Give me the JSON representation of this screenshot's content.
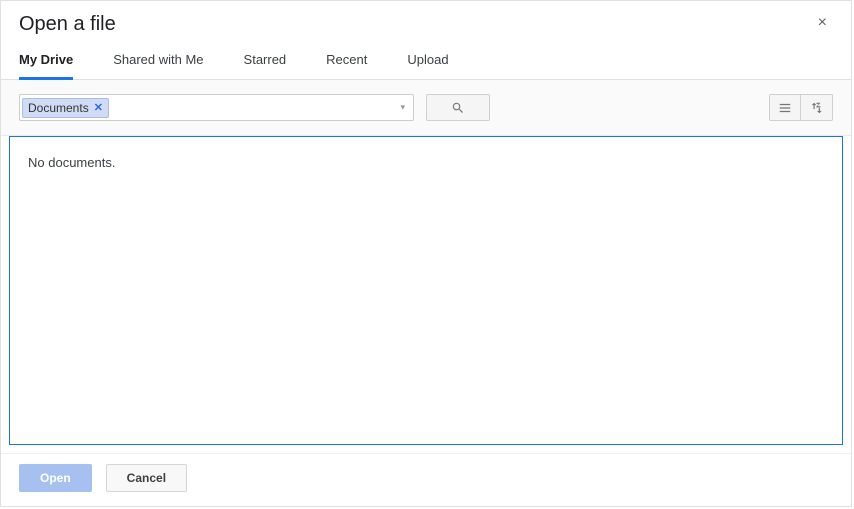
{
  "dialog": {
    "title": "Open a file",
    "close_symbol": "×"
  },
  "tabs": [
    {
      "label": "My Drive",
      "active": true
    },
    {
      "label": "Shared with Me",
      "active": false
    },
    {
      "label": "Starred",
      "active": false
    },
    {
      "label": "Recent",
      "active": false
    },
    {
      "label": "Upload",
      "active": false
    }
  ],
  "breadcrumb": {
    "chip_label": "Documents",
    "chip_close": "✕",
    "dropdown_symbol": "▾"
  },
  "content": {
    "empty_message": "No documents."
  },
  "footer": {
    "open_label": "Open",
    "cancel_label": "Cancel"
  }
}
